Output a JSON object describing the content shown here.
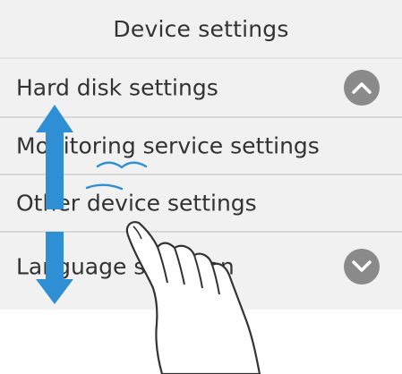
{
  "header": {
    "title": "Device settings"
  },
  "menu": {
    "items": [
      {
        "label": "Hard disk settings"
      },
      {
        "label": "Monitoring service settings"
      },
      {
        "label": "Other device settings"
      },
      {
        "label": "Language selection"
      }
    ]
  },
  "scroll": {
    "up_icon": "chevron-up-icon",
    "down_icon": "chevron-down-icon"
  },
  "gesture": {
    "icon": "swipe-hand-icon",
    "arrow_icon": "up-down-arrow-icon",
    "arrow_color": "#2f8fd4"
  },
  "colors": {
    "panel_background": "#f1f1f1",
    "divider": "#d8d8d8",
    "text": "#333333",
    "scroll_button": "#8a8a8a"
  }
}
